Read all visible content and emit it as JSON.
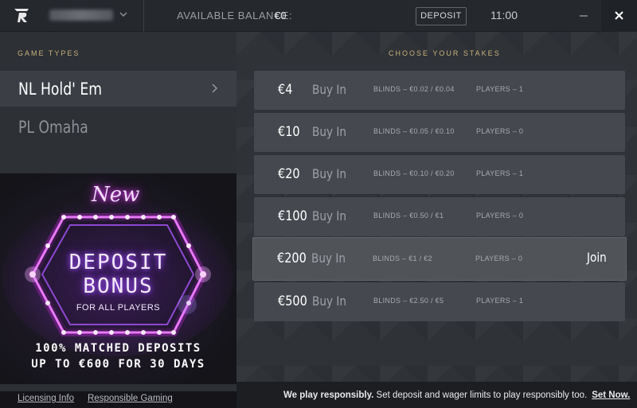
{
  "header": {
    "balance_label": "AVAILABLE BALANCE:",
    "balance_value": "€0",
    "deposit_label": "DEPOSIT",
    "time": "11:00"
  },
  "left_panel": {
    "section_title": "GAME TYPES",
    "game_types": [
      {
        "label": "NL Hold' Em",
        "active": true
      },
      {
        "label": "PL Omaha",
        "active": false
      }
    ],
    "promo": {
      "new": "New",
      "line1": "DEPOSIT",
      "line2": "BONUS",
      "line3": "FOR ALL PLAYERS",
      "tagline1": "100% MATCHED DEPOSITS",
      "tagline2": "UP TO €600 FOR 30 DAYS"
    },
    "links": {
      "licensing": "Licensing Info",
      "responsible": "Responsible Gaming"
    }
  },
  "right_panel": {
    "section_title": "CHOOSE YOUR STAKES",
    "stakes": [
      {
        "amount": "€4",
        "buy_in": "Buy In",
        "blinds": "BLINDS – €0.02 / €0.04",
        "players": "PLAYERS – 1",
        "join": ""
      },
      {
        "amount": "€10",
        "buy_in": "Buy In",
        "blinds": "BLINDS – €0.05 / €0.10",
        "players": "PLAYERS – 0",
        "join": ""
      },
      {
        "amount": "€20",
        "buy_in": "Buy In",
        "blinds": "BLINDS – €0.10 / €0.20",
        "players": "PLAYERS – 1",
        "join": ""
      },
      {
        "amount": "€100",
        "buy_in": "Buy In",
        "blinds": "BLINDS – €0.50 / €1",
        "players": "PLAYERS – 0",
        "join": ""
      },
      {
        "amount": "€200",
        "buy_in": "Buy In",
        "blinds": "BLINDS – €1 / €2",
        "players": "PLAYERS – 0",
        "join": "Join"
      },
      {
        "amount": "€500",
        "buy_in": "Buy In",
        "blinds": "BLINDS – €2.50 / €5",
        "players": "PLAYERS – 1",
        "join": ""
      }
    ]
  },
  "footer": {
    "bold": "We play responsibly.",
    "text": " Set deposit and wager limits to play responsibly too.",
    "cta": "Set Now."
  },
  "icons": {
    "logo": "logo-icon",
    "user_menu": "chevron-down-icon",
    "minimize": "minimize-icon",
    "close": "close-icon",
    "game_arrow": "chevron-right-icon"
  },
  "colors": {
    "accent_gold": "#c7b27c",
    "neon_pink": "#e040fb",
    "neon_purple": "#a855f7"
  }
}
